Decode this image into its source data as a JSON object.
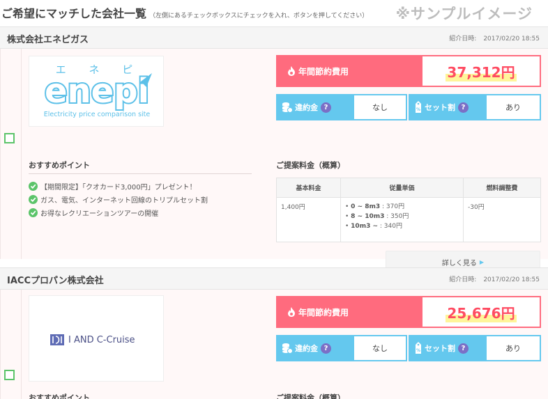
{
  "header": {
    "title": "ご希望にマッチした会社一覧",
    "subtitle": "（左側にあるチェックボックスにチェックを入れ、ボタンを押してください）",
    "sample_label": "※サンプルイメージ"
  },
  "companies": [
    {
      "name": "株式会社エネピガス",
      "intro_label": "紹介日時:",
      "intro_date": "2017/02/20 18:55",
      "logo": {
        "kana": "エ ネ ピ",
        "word": "enepi",
        "tagline": "Electricity price comparison site"
      },
      "saving_label": "年間節約費用",
      "saving_amount": "37,312円",
      "penalty_label": "違約金",
      "penalty_value": "なし",
      "set_label": "セット割",
      "set_value": "あり",
      "points_title": "おすすめポイント",
      "points": [
        "【期間限定】「クオカード3,000円」プレゼント！",
        "ガス、電気、インターネット回線のトリプルセット割",
        "お得なレクリエーションツアーの開催"
      ],
      "plan_title": "ご提案料金（概算）",
      "plan_headers": [
        "基本料金",
        "従量単価",
        "燃料調整費"
      ],
      "base_fee": "1,400円",
      "unit_prices": [
        {
          "range": "0 ~ 8m3",
          "price": ": 370円"
        },
        {
          "range": "8 ~ 10m3",
          "price": ": 350円"
        },
        {
          "range": "10m3 ~",
          "price": ": 340円"
        }
      ],
      "fuel_adj": "-30円",
      "detail_button": "詳しく見る"
    },
    {
      "name": "IACCプロパン株式会社",
      "intro_label": "紹介日時:",
      "intro_date": "2017/02/20 18:55",
      "logo_text": "I AND C-Cruise",
      "saving_label": "年間節約費用",
      "saving_amount": "25,676円",
      "penalty_label": "違約金",
      "penalty_value": "なし",
      "set_label": "セット割",
      "set_value": "あり",
      "points_title": "おすすめポイント",
      "plan_title": "ご提案料金（概算）"
    }
  ],
  "colors": {
    "saving_pink": "#ff6b7e",
    "amount_red": "#ff4c62",
    "option_blue": "#64c8ee",
    "check_green": "#5cc46a",
    "question_purple": "#7b6fc6"
  }
}
